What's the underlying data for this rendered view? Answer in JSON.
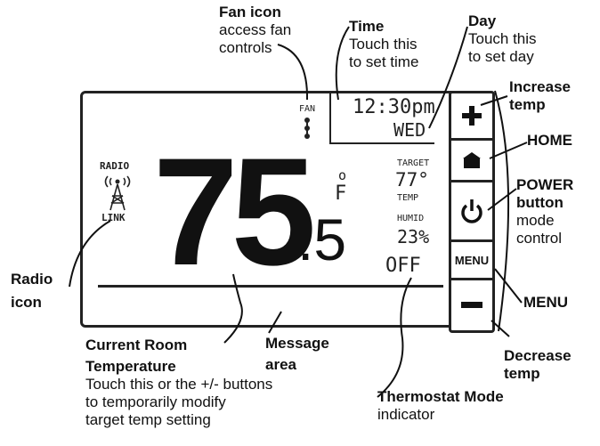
{
  "labels": {
    "fan_icon": {
      "title": "Fan icon",
      "line1": "access fan",
      "line2": "controls"
    },
    "time": {
      "title": "Time",
      "line1": "Touch this",
      "line2": "to set time"
    },
    "day": {
      "title": "Day",
      "line1": "Touch this",
      "line2": "to set day"
    },
    "increase": {
      "line1": "Increase",
      "line2": "temp"
    },
    "home": "HOME",
    "power": {
      "line1": "POWER",
      "line2": "button",
      "line3": "mode",
      "line4": "control"
    },
    "menu": "MENU",
    "decrease": {
      "line1": "Decrease",
      "line2": "temp"
    },
    "radio": {
      "line1": "Radio",
      "line2": "icon"
    },
    "current": {
      "line1": "Current Room",
      "line2": "Temperature",
      "line3": "Touch this or the +/- buttons",
      "line4": "to temporarily modify",
      "line5": "target temp setting"
    },
    "message": {
      "line1": "Message",
      "line2": "area"
    },
    "mode": {
      "line1": "Thermostat Mode",
      "line2": "indicator"
    }
  },
  "display": {
    "fan_label": "FAN",
    "time": "12:30pm",
    "day": "WED",
    "radio_label": "RADIO",
    "link_label": "LINK",
    "temp_whole": "75",
    "temp_fraction": ".5",
    "degree_symbol": "o",
    "unit": "F",
    "target_label": "TARGET",
    "target_value": "77°",
    "temp_label": "TEMP",
    "humid_label": "HUMID",
    "humid_value": "23%",
    "mode": "OFF"
  },
  "buttons": {
    "plus": "+",
    "menu": "MENU",
    "minus": "−"
  }
}
